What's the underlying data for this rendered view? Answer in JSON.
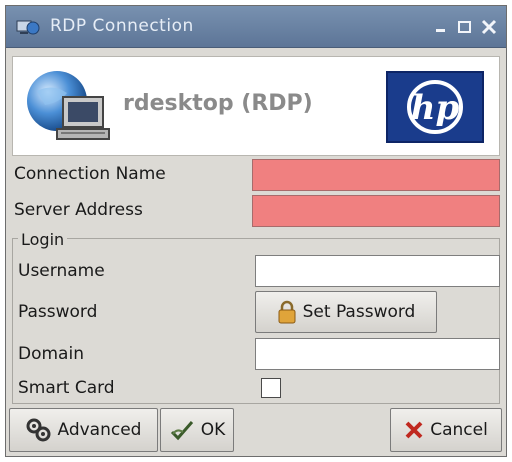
{
  "window": {
    "title": "RDP Connection",
    "colors": {
      "titlebar": "#6a82a4",
      "required": "#f08080",
      "hp_blue": "#1a3c8c"
    }
  },
  "header": {
    "app_title": "rdesktop (RDP)",
    "logo_text": "hp"
  },
  "form": {
    "connection_name_label": "Connection Name",
    "connection_name_value": "",
    "server_address_label": "Server Address",
    "server_address_value": "",
    "login": {
      "legend": "Login",
      "username_label": "Username",
      "username_value": "",
      "password_label": "Password",
      "set_password_label": "Set Password",
      "domain_label": "Domain",
      "domain_value": "",
      "smart_card_label": "Smart Card",
      "smart_card_checked": false
    }
  },
  "buttons": {
    "advanced": "Advanced",
    "ok": "OK",
    "cancel": "Cancel"
  },
  "icons": [
    "app-icon",
    "minimize-icon",
    "maximize-icon",
    "close-icon",
    "computer-icon",
    "hp-logo",
    "lock-icon",
    "advanced-icon",
    "ok-icon",
    "cancel-icon"
  ]
}
